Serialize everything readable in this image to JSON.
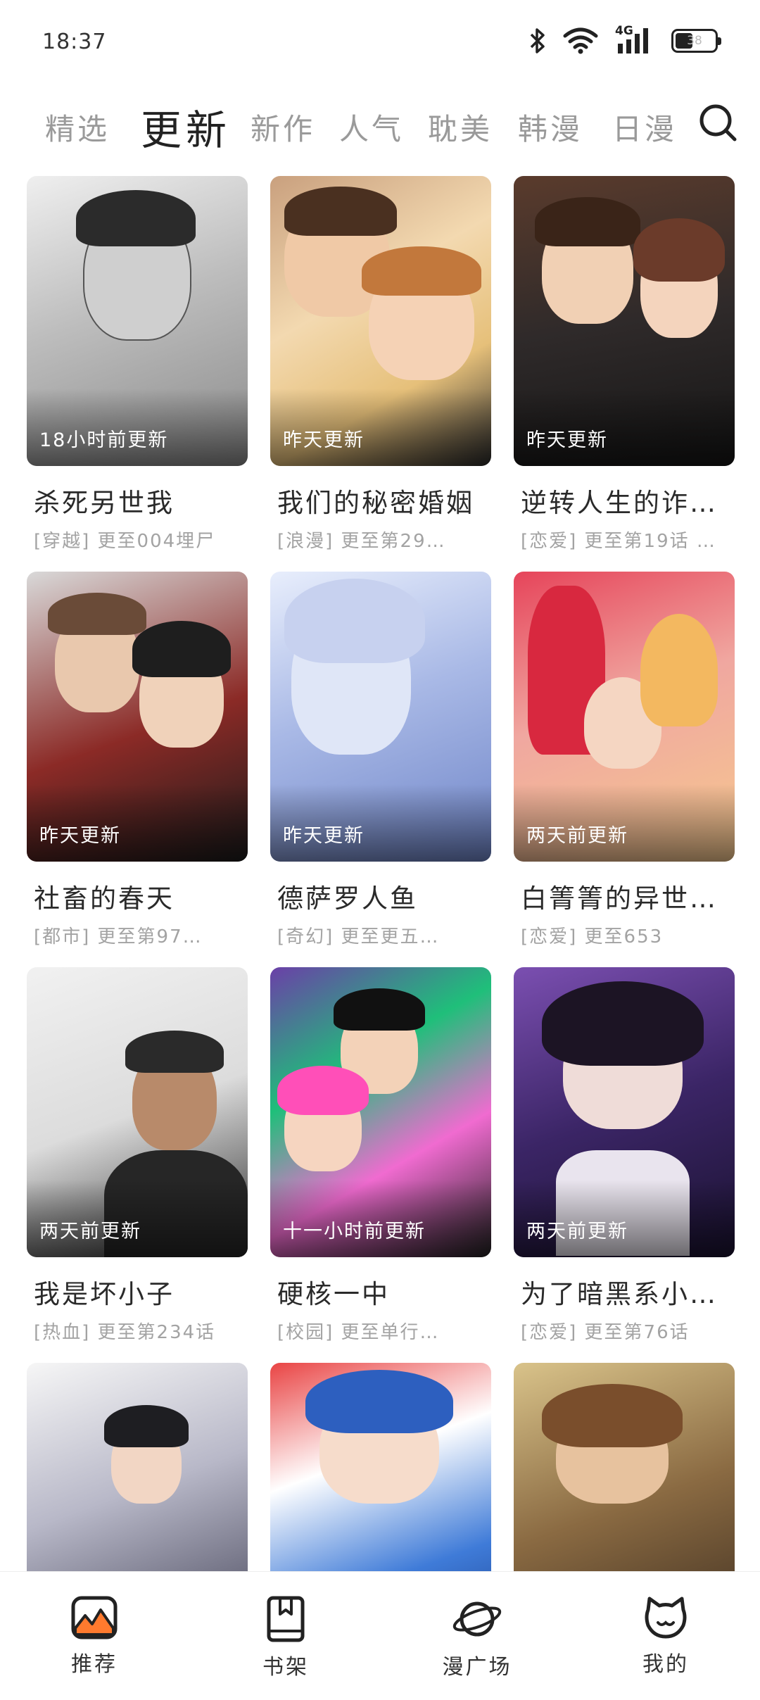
{
  "status": {
    "time": "18:37",
    "network": "4G",
    "battery": "38"
  },
  "tabs": [
    {
      "label": "精选",
      "active": false
    },
    {
      "label": "更新",
      "active": true
    },
    {
      "label": "新作",
      "active": false
    },
    {
      "label": "人气",
      "active": false
    },
    {
      "label": "耽美",
      "active": false
    },
    {
      "label": "韩漫",
      "active": false
    },
    {
      "label": "日漫",
      "active": false
    }
  ],
  "comics": [
    {
      "label": "18小时前更新",
      "title": "杀死另世我",
      "subtitle": "[穿越] 更至004埋尸"
    },
    {
      "label": "昨天更新",
      "title": "我们的秘密婚姻",
      "subtitle": "[浪漫] 更至第29…"
    },
    {
      "label": "昨天更新",
      "title": "逆转人生的诈…",
      "subtitle": "[恋爱] 更至第19话 …"
    },
    {
      "label": "昨天更新",
      "title": "社畜的春天",
      "subtitle": "[都市] 更至第97…"
    },
    {
      "label": "昨天更新",
      "title": "德萨罗人鱼",
      "subtitle": "[奇幻] 更至更五…"
    },
    {
      "label": "两天前更新",
      "title": "白箐箐的异世…",
      "subtitle": "[恋爱] 更至653"
    },
    {
      "label": "两天前更新",
      "title": "我是坏小子",
      "subtitle": "[热血] 更至第234话"
    },
    {
      "label": "十一小时前更新",
      "title": "硬核一中",
      "subtitle": "[校园] 更至单行…"
    },
    {
      "label": "两天前更新",
      "title": "为了暗黑系小…",
      "subtitle": "[恋爱] 更至第76话"
    },
    {
      "label": "",
      "title": "",
      "subtitle": ""
    },
    {
      "label": "",
      "title": "",
      "subtitle": ""
    },
    {
      "label": "",
      "title": "",
      "subtitle": ""
    }
  ],
  "bottom_nav": [
    {
      "label": "推荐",
      "icon": "recommend-icon"
    },
    {
      "label": "书架",
      "icon": "bookshelf-icon"
    },
    {
      "label": "漫广场",
      "icon": "planet-icon"
    },
    {
      "label": "我的",
      "icon": "cat-face-icon"
    }
  ]
}
